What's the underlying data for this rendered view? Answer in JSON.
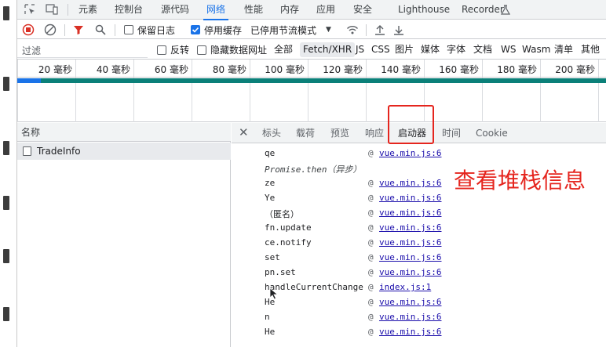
{
  "devtools": {
    "main_tabs": [
      "元素",
      "控制台",
      "源代码",
      "网络",
      "性能",
      "内存",
      "应用",
      "安全",
      "Lighthouse",
      "Recorder"
    ],
    "active_tab": "网络"
  },
  "toolbar": {
    "preserve_log": "保留日志",
    "disable_cache": "停用缓存",
    "throttling": "已停用节流模式"
  },
  "filter": {
    "placeholder": "过滤",
    "invert": "反转",
    "hide_data_urls": "隐藏数据网址",
    "types": [
      "全部",
      "Fetch/XHR",
      "JS",
      "CSS",
      "图片",
      "媒体",
      "字体",
      "文档",
      "WS",
      "Wasm",
      "清单",
      "其他"
    ],
    "active_type": "Fetch/XHR"
  },
  "timeline": {
    "ticks": [
      "20 毫秒",
      "40 毫秒",
      "60 毫秒",
      "80 毫秒",
      "100 毫秒",
      "120 毫秒",
      "140 毫秒",
      "160 毫秒",
      "180 毫秒",
      "200 毫秒"
    ]
  },
  "request_list": {
    "header": "名称",
    "rows": [
      "TradeInfo"
    ]
  },
  "detail": {
    "tabs": [
      "标头",
      "载荷",
      "预览",
      "响应",
      "启动器",
      "时间",
      "Cookie"
    ],
    "active_tab": "启动器",
    "stack": [
      {
        "fn": "qe",
        "at": "@",
        "src": "vue.min.js:6"
      },
      {
        "fn": "Promise.then（异步）",
        "at": "",
        "src": ""
      },
      {
        "fn": "ze",
        "at": "@",
        "src": "vue.min.js:6"
      },
      {
        "fn": "Ye",
        "at": "@",
        "src": "vue.min.js:6"
      },
      {
        "fn": "（匿名）",
        "at": "@",
        "src": "vue.min.js:6"
      },
      {
        "fn": "fn.update",
        "at": "@",
        "src": "vue.min.js:6"
      },
      {
        "fn": "ce.notify",
        "at": "@",
        "src": "vue.min.js:6"
      },
      {
        "fn": "set",
        "at": "@",
        "src": "vue.min.js:6"
      },
      {
        "fn": "pn.set",
        "at": "@",
        "src": "vue.min.js:6"
      },
      {
        "fn": "handleCurrentChange",
        "at": "@",
        "src": "index.js:1"
      },
      {
        "fn": "He",
        "at": "@",
        "src": "vue.min.js:6"
      },
      {
        "fn": "n",
        "at": "@",
        "src": "vue.min.js:6"
      },
      {
        "fn": "He",
        "at": "@",
        "src": "vue.min.js:6"
      }
    ]
  },
  "annotation": {
    "text": "查看堆栈信息",
    "color": "#e5251e"
  },
  "colors": {
    "accent": "#1a73e8",
    "record_red": "#d93025",
    "timeline_teal": "#0b8079",
    "link": "#1a0dab"
  }
}
